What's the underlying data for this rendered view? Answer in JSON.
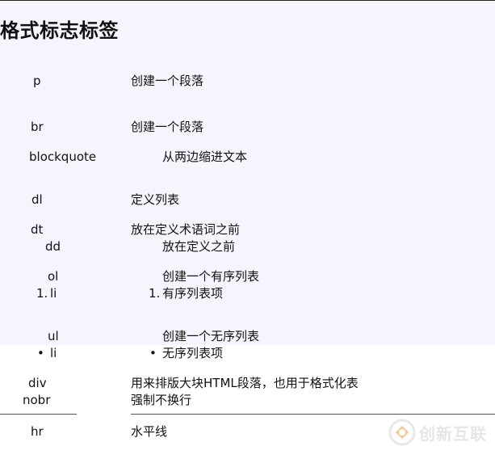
{
  "title": "格式标志标签",
  "rows": {
    "p": {
      "tag": "p",
      "desc": "创建一个段落"
    },
    "br": {
      "tag": "br",
      "desc": "创建一个段落"
    },
    "blockquote": {
      "tag": "blockquote",
      "desc": "从两边缩进文本"
    },
    "dl": {
      "tag": "dl",
      "desc": "定义列表"
    },
    "dt": {
      "tag": "dt",
      "desc": "放在定义术语词之前"
    },
    "dd": {
      "tag": "dd",
      "desc": "放在定义之前"
    },
    "ol": {
      "tag": "ol",
      "desc": "创建一个有序列表"
    },
    "li_ordered": {
      "marker": "1.",
      "tag": "li",
      "desc_marker": "1.",
      "desc": "有序列表项"
    },
    "ul": {
      "tag": "ul",
      "desc": "创建一个无序列表"
    },
    "li_unordered": {
      "marker": "•",
      "tag": "li",
      "desc_marker": "•",
      "desc": "无序列表项"
    },
    "div": {
      "tag": "div",
      "desc": "用来排版大块HTML段落，也用于格式化表"
    },
    "nobr": {
      "tag": "nobr",
      "desc": "强制不换行"
    },
    "hr": {
      "tag": "hr",
      "desc": "水平线"
    }
  },
  "watermark": {
    "text": "创新互联",
    "icon": "brand-logo-icon",
    "color": "#e6e6e6"
  }
}
